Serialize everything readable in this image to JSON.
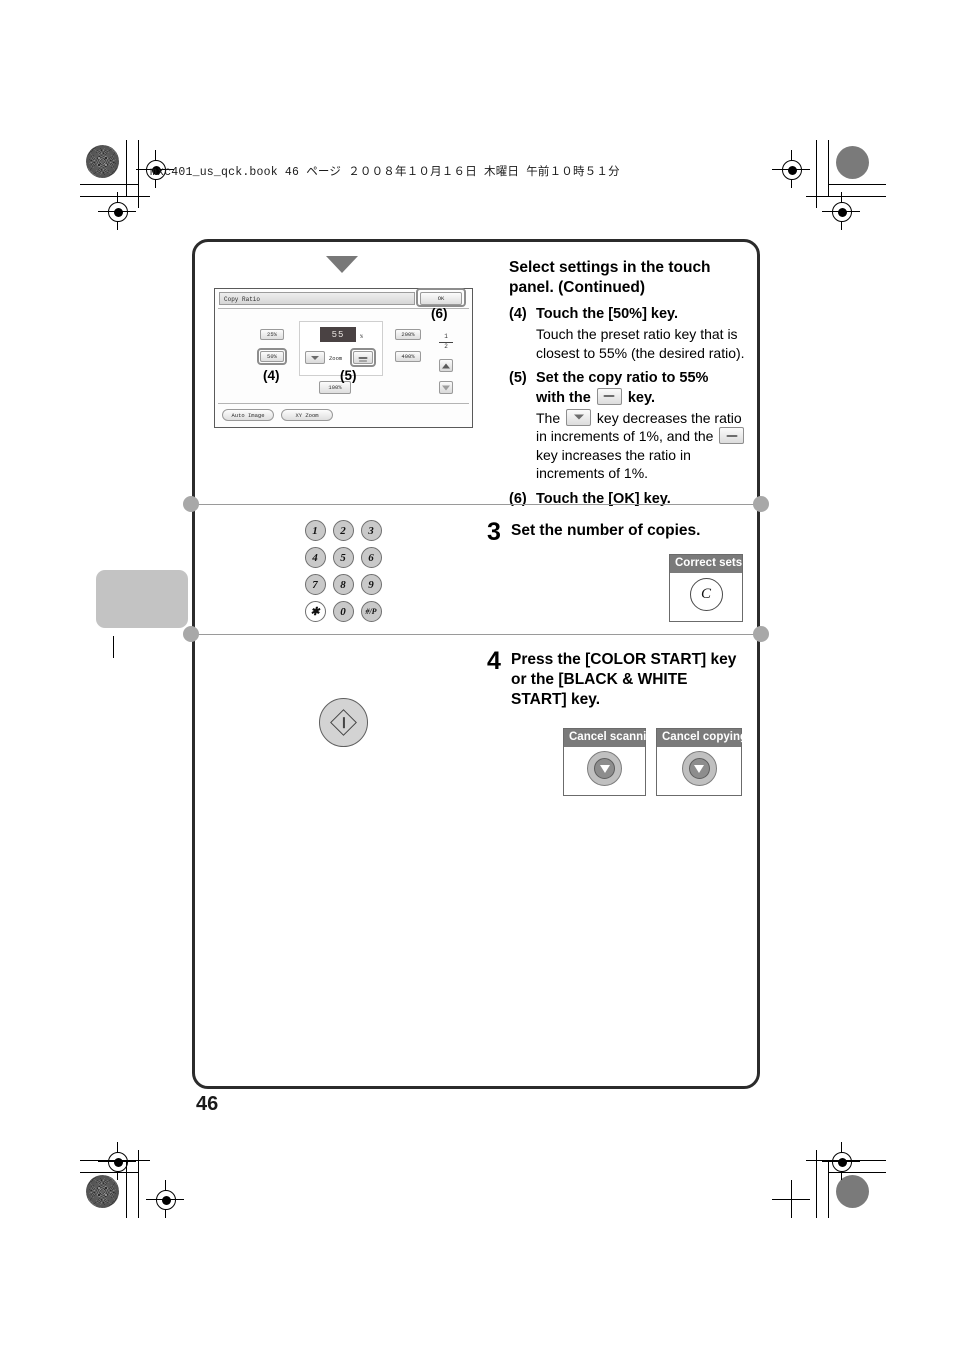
{
  "header": {
    "book_line": "mxc401_us_qck.book   46 ページ   ２００８年１０月１６日   木曜日   午前１０時５１分"
  },
  "page_number": "46",
  "sections": [
    {
      "id": "step2-cont",
      "title": "Select settings in the touch panel. (Continued)",
      "items": [
        {
          "num": "(4)",
          "bold": "Touch the [50%] key.",
          "body": "Touch the preset ratio key that is closest to 55% (the desired ratio)."
        },
        {
          "num": "(5)",
          "bold_a": "Set the copy ratio to 55%",
          "bold_b": "with the",
          "bold_c": "key.",
          "body_a": "The",
          "body_b": "key decreases the ratio in increments of 1%, and the",
          "body_c": "key increases the ratio in increments of 1%."
        },
        {
          "num": "(6)",
          "bold": "Touch the [OK] key."
        }
      ]
    },
    {
      "id": "step3",
      "number": "3",
      "title": "Set the number of copies."
    },
    {
      "id": "step4",
      "number": "4",
      "title": "Press the [COLOR START] key or the [BLACK & WHITE START] key."
    }
  ],
  "touch_panel": {
    "title": "Copy Ratio",
    "ok_label": "OK",
    "ratio_value": "55",
    "percent_sign": "%",
    "zoom_label": "Zoom",
    "preset_left": [
      "25%",
      "50%"
    ],
    "preset_right": [
      "200%",
      "400%"
    ],
    "reset_key": "100%",
    "bottom_keys": [
      "Auto Image",
      "XY Zoom"
    ],
    "page_fraction": {
      "numerator": "1",
      "denominator": "2"
    },
    "callouts": [
      "(4)",
      "(5)",
      "(6)"
    ]
  },
  "keypad": {
    "keys": [
      "1",
      "2",
      "3",
      "4",
      "5",
      "6",
      "7",
      "8",
      "9",
      "✱",
      "0",
      "#/P"
    ]
  },
  "callout_boxes": {
    "correct_sets": "Correct sets",
    "correct_sets_key": "C",
    "cancel_scanning": "Cancel scanning",
    "cancel_copying": "Cancel copying"
  }
}
